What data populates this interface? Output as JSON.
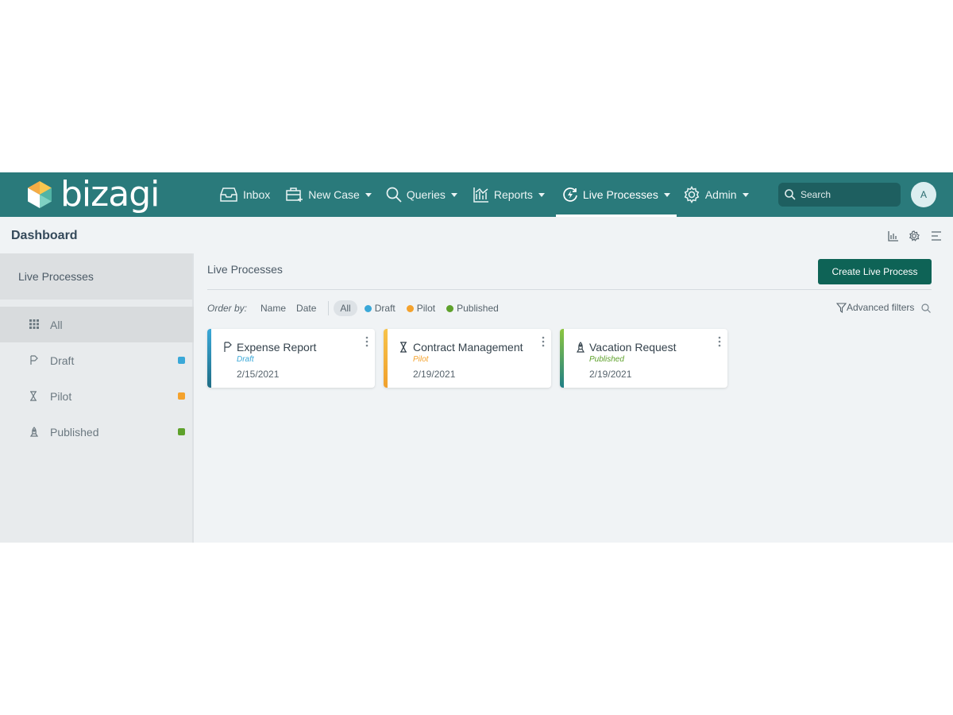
{
  "app": {
    "logo_text": "bizagi",
    "brand_color": "#2a7a7b"
  },
  "nav": {
    "items": [
      {
        "label": "Inbox",
        "icon": "inbox-icon",
        "dropdown": false
      },
      {
        "label": "New Case",
        "icon": "new-case-icon",
        "dropdown": true
      },
      {
        "label": "Queries",
        "icon": "search-icon",
        "dropdown": true
      },
      {
        "label": "Reports",
        "icon": "reports-icon",
        "dropdown": true
      },
      {
        "label": "Live Processes",
        "icon": "live-processes-icon",
        "dropdown": true,
        "active": true
      },
      {
        "label": "Admin",
        "icon": "gear-icon",
        "dropdown": true
      }
    ],
    "search_placeholder": "Search",
    "avatar_initial": "A"
  },
  "page": {
    "title": "Dashboard",
    "tools": [
      "bar-chart-icon",
      "gear-network-icon",
      "list-icon"
    ]
  },
  "sidebar": {
    "header": "Live Processes",
    "items": [
      {
        "label": "All",
        "icon": "grid-icon",
        "selected": true
      },
      {
        "label": "Draft",
        "icon": "draft-icon",
        "dot_color": "#3aa8d8"
      },
      {
        "label": "Pilot",
        "icon": "hourglass-icon",
        "dot_color": "#f4a22d"
      },
      {
        "label": "Published",
        "icon": "rocket-icon",
        "dot_color": "#5ea12b"
      }
    ]
  },
  "main": {
    "title": "Live Processes",
    "create_button": "Create Live Process",
    "order_by_label": "Order by:",
    "order_options": [
      "Name",
      "Date"
    ],
    "filters": [
      {
        "label": "All",
        "selected": true
      },
      {
        "label": "Draft",
        "color": "#3aa8d8"
      },
      {
        "label": "Pilot",
        "color": "#f4a22d"
      },
      {
        "label": "Published",
        "color": "#5ea12b"
      }
    ],
    "advanced_filters": "Advanced filters"
  },
  "cards": [
    {
      "title": "Expense Report",
      "status": "Draft",
      "date": "2/15/2021",
      "icon": "draft-icon",
      "status_color": "#3aa8d8"
    },
    {
      "title": "Contract Management",
      "status": "Pilot",
      "date": "2/19/2021",
      "icon": "hourglass-icon",
      "status_color": "#f4a22d"
    },
    {
      "title": "Vacation Request",
      "status": "Published",
      "date": "2/19/2021",
      "icon": "rocket-icon",
      "status_color": "#5ea12b"
    }
  ]
}
